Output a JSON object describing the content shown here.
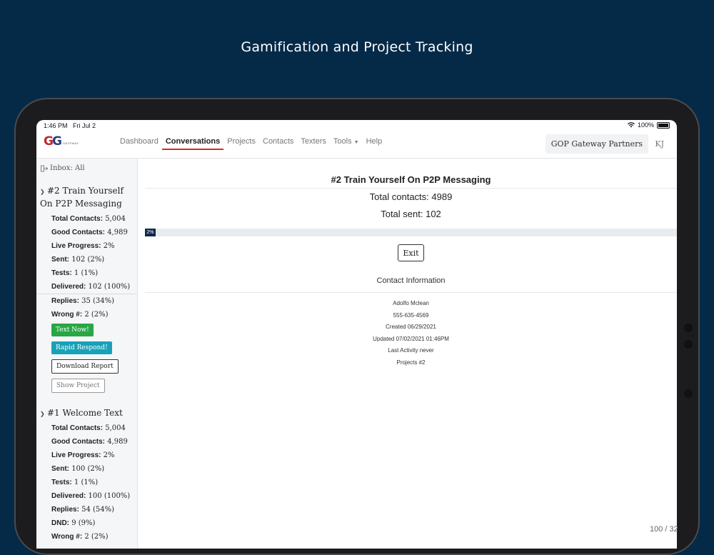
{
  "heading": "Gamification and Project Tracking",
  "status_bar": {
    "time": "1:46 PM",
    "date": "Fri Jul 2",
    "battery": "100%"
  },
  "nav": {
    "logo_letters": [
      "G",
      "G"
    ],
    "logo_sub": "GATEWAY",
    "links": [
      "Dashboard",
      "Conversations",
      "Projects",
      "Contacts",
      "Texters",
      "Tools",
      "Help"
    ],
    "active": "Conversations",
    "org_name": "GOP Gateway Partners",
    "user_initials": "KJ"
  },
  "sidebar": {
    "inbox_label": "Inbox: All",
    "projects": [
      {
        "title": "#2 Train Yourself On P2P Messaging",
        "stats": [
          {
            "label": "Total Contacts:",
            "value": "5,004"
          },
          {
            "label": "Good Contacts:",
            "value": "4,989"
          },
          {
            "label": "Live Progress:",
            "value": "2%"
          },
          {
            "label": "Sent:",
            "value": "102 (2%)"
          },
          {
            "label": "Tests:",
            "value": "1 (1%)"
          },
          {
            "label": "Delivered:",
            "value": "102 (100%)"
          },
          {
            "label": "Replies:",
            "value": "35 (34%)"
          },
          {
            "label": "Wrong #:",
            "value": "2 (2%)"
          }
        ],
        "buttons": {
          "text_now": "Text Now!",
          "rapid_respond": "Rapid Respond!",
          "download_report": "Download Report",
          "show_project": "Show Project"
        }
      },
      {
        "title": "#1 Welcome Text",
        "stats": [
          {
            "label": "Total Contacts:",
            "value": "5,004"
          },
          {
            "label": "Good Contacts:",
            "value": "4,989"
          },
          {
            "label": "Live Progress:",
            "value": "2%"
          },
          {
            "label": "Sent:",
            "value": "100 (2%)"
          },
          {
            "label": "Tests:",
            "value": "1 (1%)"
          },
          {
            "label": "Delivered:",
            "value": "100 (100%)"
          },
          {
            "label": "Replies:",
            "value": "54 (54%)"
          },
          {
            "label": "DND:",
            "value": "9 (9%)"
          },
          {
            "label": "Wrong #:",
            "value": "2 (2%)"
          }
        ]
      }
    ]
  },
  "main": {
    "title": "#2 Train Yourself On P2P Messaging",
    "total_contacts": "Total contacts: 4989",
    "total_sent": "Total sent: 102",
    "progress_label": "2%",
    "progress_fraction": 0.02,
    "exit_label": "Exit",
    "contact_info_title": "Contact Information",
    "contact": {
      "name": "Adolfo Mclean",
      "phone": "555-635-4569",
      "created": "Created 06/29/2021",
      "updated": "Updated 07/02/2021 01:46PM",
      "last_activity": "Last Activity never",
      "projects": "Projects #2"
    }
  },
  "pager": "100 / 32",
  "colors": {
    "background": "#042a48",
    "accent_red": "#c9302c",
    "success": "#28a745",
    "info": "#17a2b8",
    "progress": "#0f2a4a"
  }
}
